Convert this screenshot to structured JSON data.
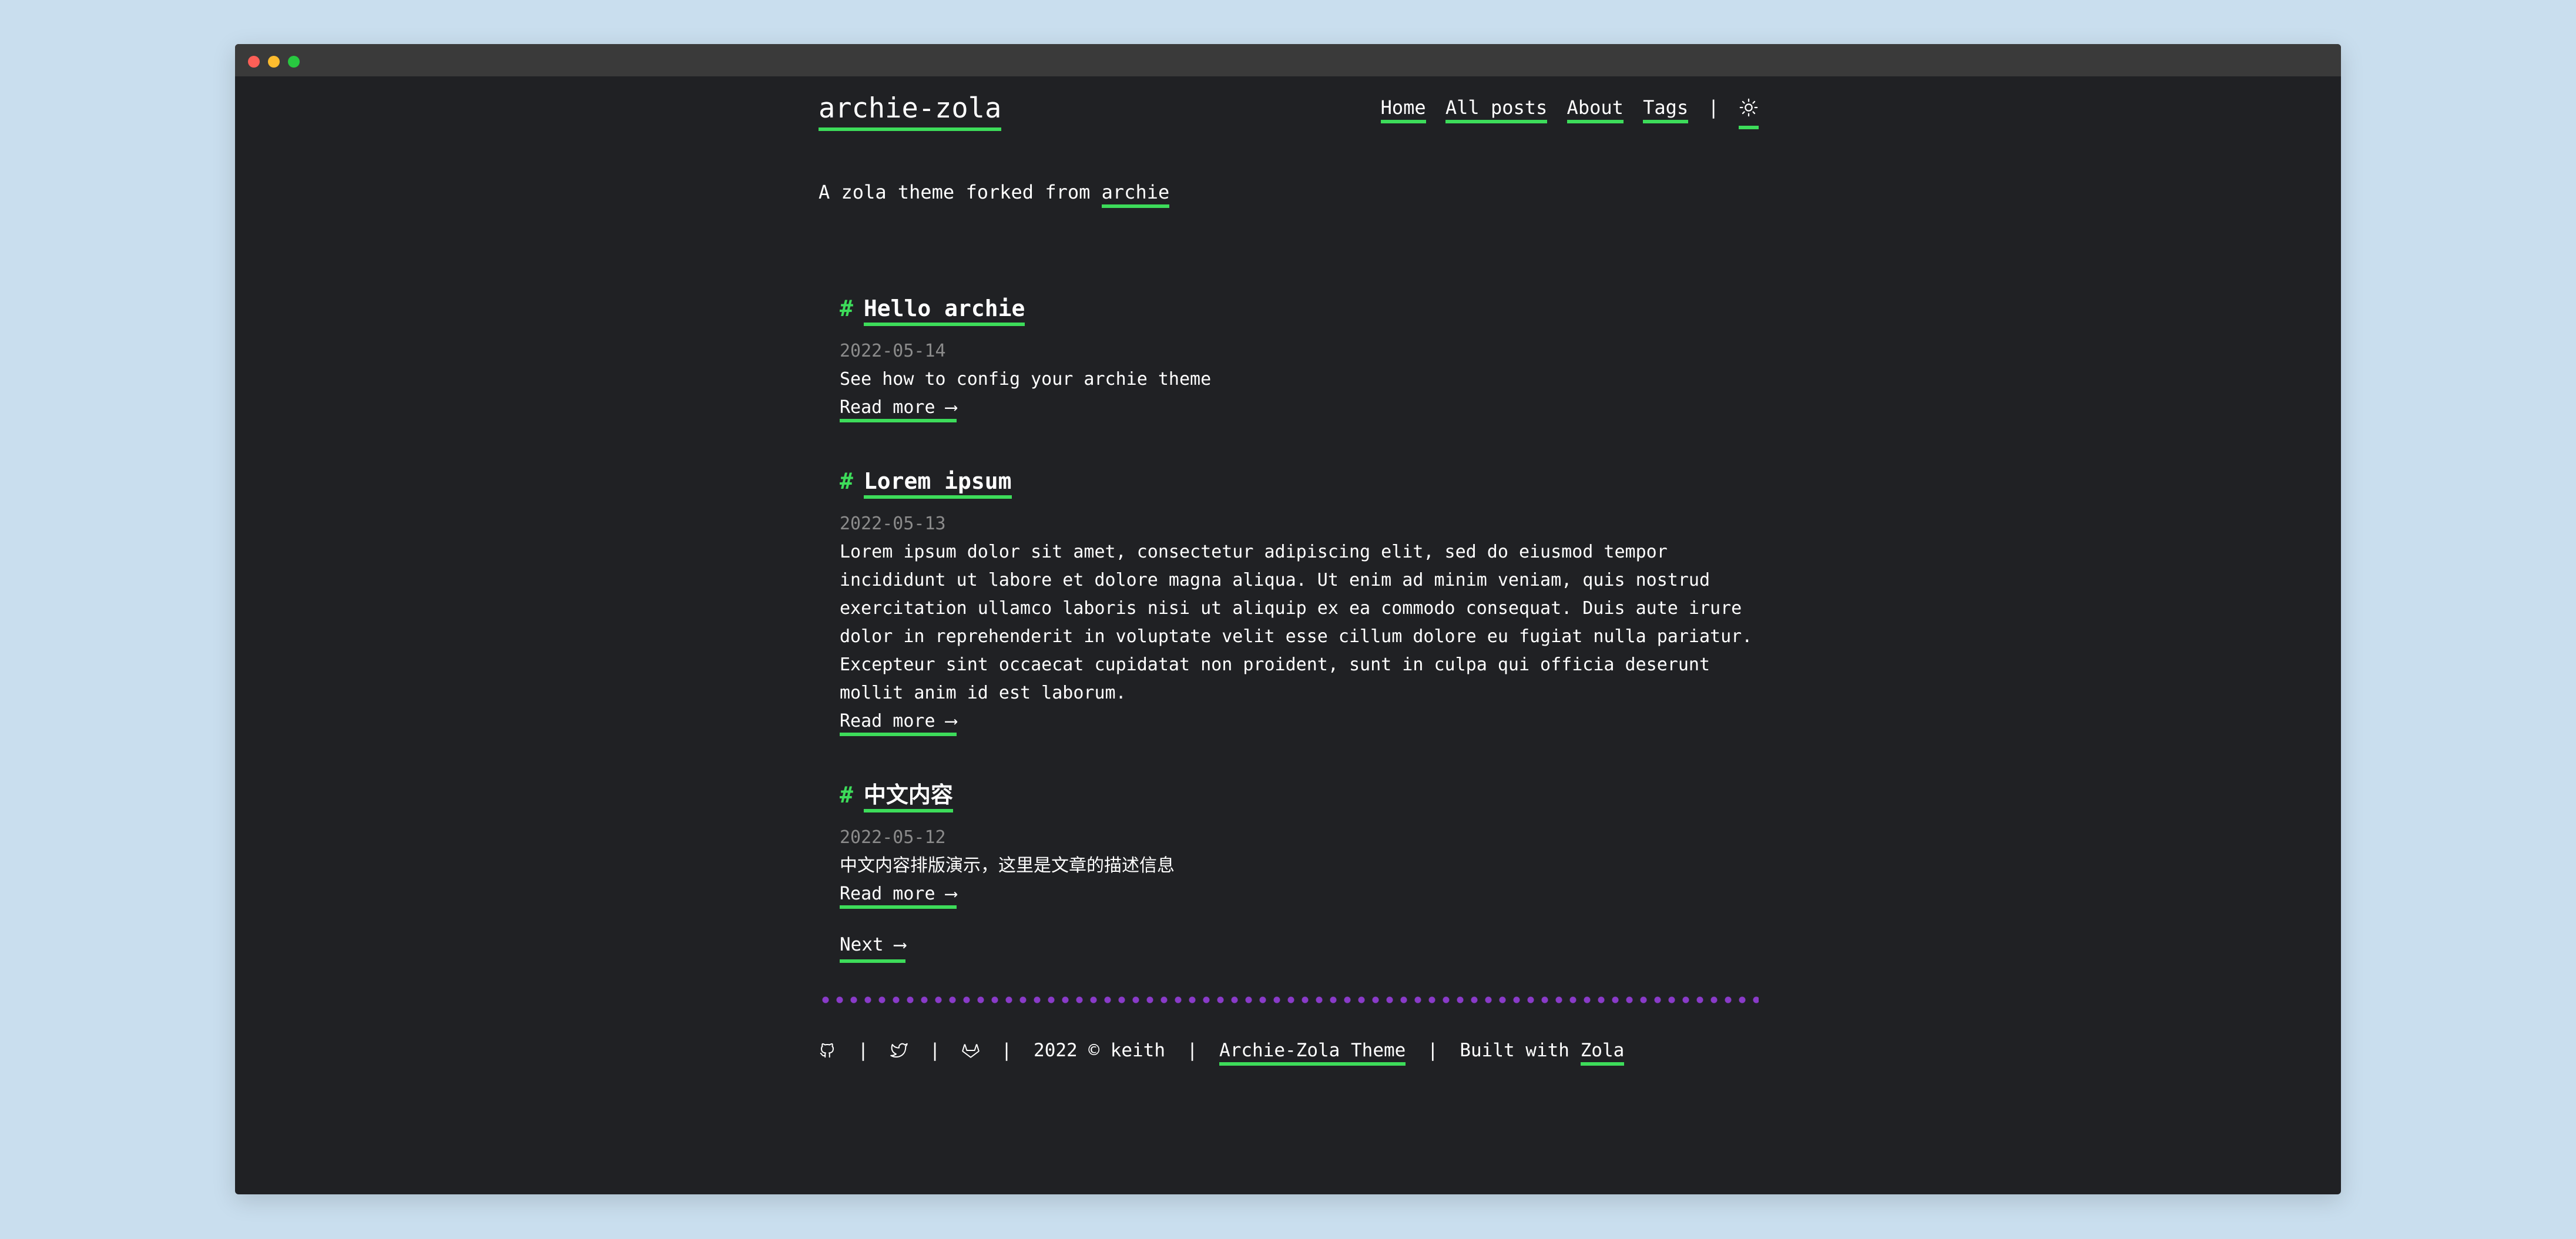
{
  "site": {
    "title": "archie-zola",
    "tagline_prefix": "A zola theme forked from",
    "tagline_link": "archie"
  },
  "nav": {
    "items": [
      "Home",
      "All posts",
      "About",
      "Tags"
    ],
    "separator": "|",
    "theme_toggle_icon": "sun-icon"
  },
  "posts": [
    {
      "hash": "#",
      "title": "Hello archie",
      "date": "2022-05-14",
      "summary": "See how to config your archie theme",
      "read_more": "Read more ⟶"
    },
    {
      "hash": "#",
      "title": "Lorem ipsum",
      "date": "2022-05-13",
      "summary_lines": [
        "Lorem ipsum dolor sit amet, consectetur adipiscing elit, sed do eiusmod tempor",
        "incididunt ut labore et dolore magna aliqua. Ut enim ad minim veniam, quis nostrud",
        "exercitation ullamco laboris nisi ut aliquip ex ea commodo consequat. Duis aute irure",
        "dolor in reprehenderit in voluptate velit esse cillum dolore eu fugiat nulla pariatur.",
        "Excepteur sint occaecat cupidatat non proident, sunt in culpa qui officia deserunt",
        "mollit anim id est laborum."
      ],
      "read_more": "Read more ⟶"
    },
    {
      "hash": "#",
      "title": "中文内容",
      "date": "2022-05-12",
      "summary": "中文内容排版演示，这里是文章的描述信息",
      "read_more": "Read more ⟶"
    }
  ],
  "pagination": {
    "next": "Next ⟶"
  },
  "footer": {
    "icons": [
      "github-icon",
      "twitter-icon",
      "gitlab-icon"
    ],
    "separator": "|",
    "copyright": "2022 © keith",
    "theme_link": "Archie-Zola Theme",
    "built_with": "Built with",
    "zola_link": "Zola"
  },
  "colors": {
    "window_bg": "#202124",
    "page_bg": "#c9deee",
    "accent": "#3ddc5a",
    "divider": "#8a3bc9",
    "date": "#8b8b8b"
  }
}
